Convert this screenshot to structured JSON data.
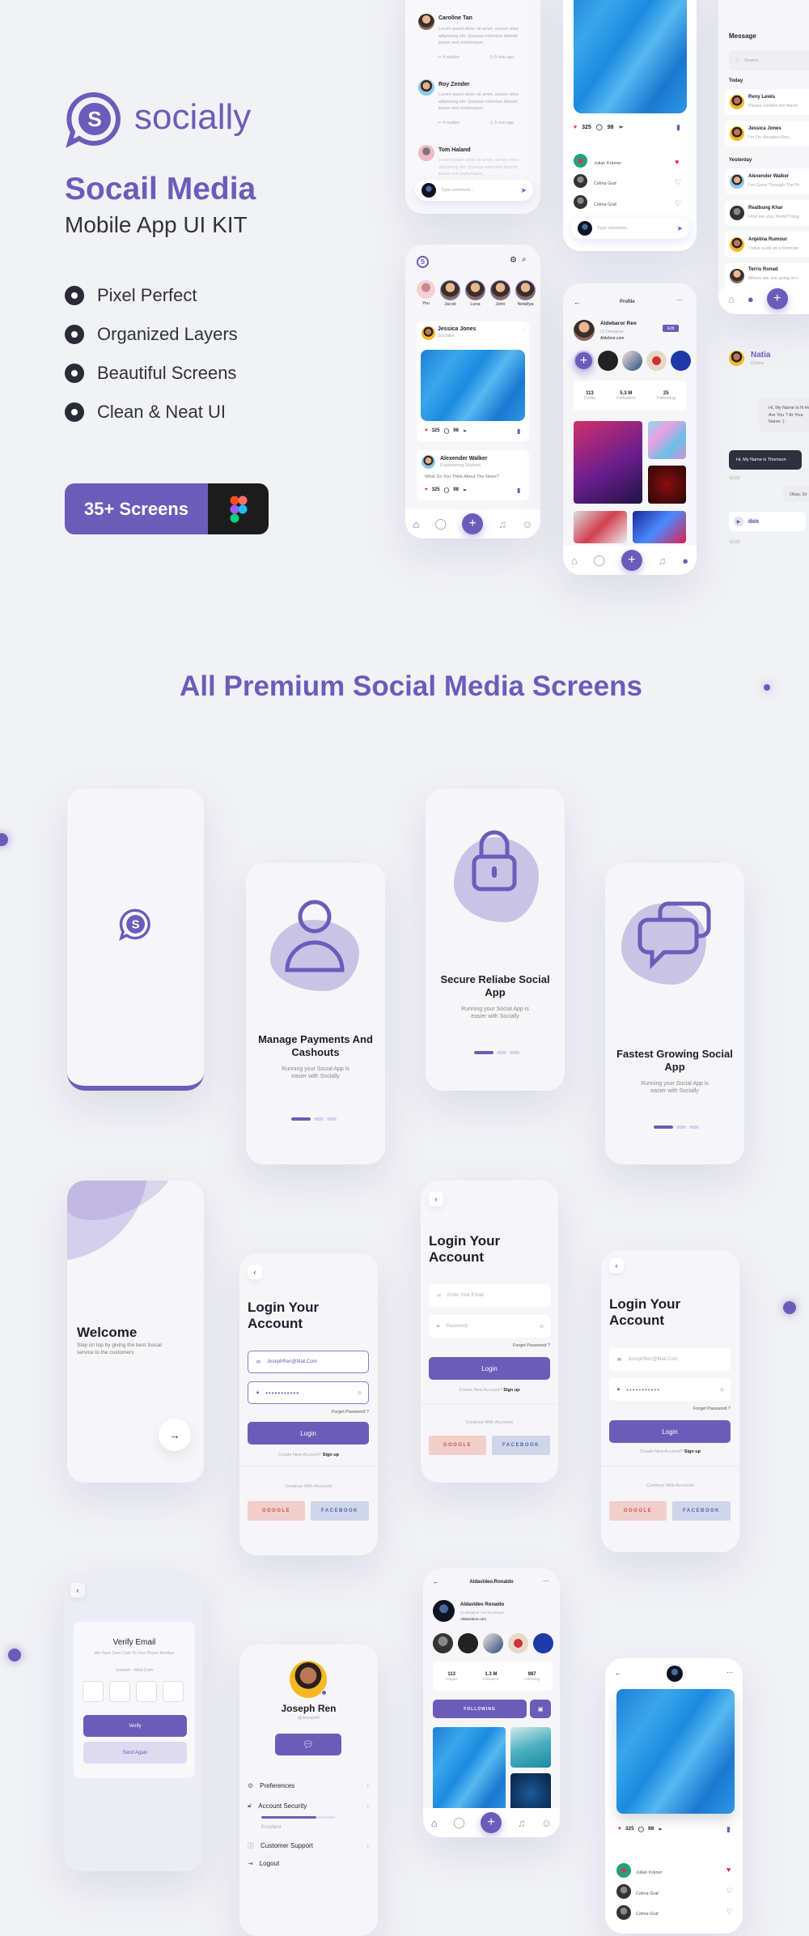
{
  "brand": {
    "name": "socially",
    "logo_letter": "S",
    "title": "Socail Media",
    "subtitle": "Mobile App UI KIT",
    "features": [
      "Pixel Perfect",
      "Organized Layers",
      "Beautiful Screens",
      "Clean & Neat UI"
    ],
    "cta": "35+ Screens",
    "accent": "#6c5cba"
  },
  "section_title": "All Premium Social Media Screens",
  "comments": [
    {
      "name": "Caroline Tan",
      "text": "Lorem ipsum dolor sit amet, consec tetur adipiscing elit. Quisque interdum blandit ipsum sed scelerisque.",
      "replies": "4 replies",
      "time": "5 min ago"
    },
    {
      "name": "Roy Zender",
      "text": "Lorem ipsum dolor sit amet, consec tetur adipiscing elit. Quisque interdum blandit ipsum sed scelerisque.",
      "replies": "4 replies",
      "time": "5 min ago"
    },
    {
      "name": "Tom Haland",
      "text": "Lorem ipsum dolor sit amet, consec tetur adipiscing elit. Quisque interdum blandit ipsum sed scelerisque."
    }
  ],
  "comment_placeholder": "Type comment...",
  "post": {
    "likes": "325",
    "comments": "98",
    "likers": [
      {
        "name": "Julian Krämer",
        "liked": true
      },
      {
        "name": "Celina Graf",
        "liked": false
      },
      {
        "name": "Celina Graf",
        "liked": false
      }
    ]
  },
  "messages": {
    "title": "Message",
    "search": "Search...",
    "today": "Today",
    "yesterday": "Yesterday",
    "items": [
      {
        "name": "Reny Lewis",
        "preview": "Please confirm the friend"
      },
      {
        "name": "Jessica Jones",
        "preview": "I'm On Vocation Ron..."
      },
      {
        "name": "Alexender Walker",
        "preview": "I've Gone Through The Pr"
      },
      {
        "name": "Realbung Khar",
        "preview": "How are you, friend? long"
      },
      {
        "name": "Anjelina Rumour",
        "preview": "I have a job as a foreman"
      },
      {
        "name": "Terris Ronad",
        "preview": "Where are you going at n"
      }
    ]
  },
  "feed": {
    "stories": [
      "You",
      "Jacob",
      "Luna",
      "John",
      "Netallya"
    ],
    "posts": [
      {
        "name": "Jessica Jones",
        "role": "Socialist",
        "likes": "325",
        "comments": "98"
      },
      {
        "name": "Alexender Walker",
        "role": "Engineering Student",
        "text": "What Do You Think About The News?",
        "likes": "325",
        "comments": "98"
      }
    ]
  },
  "profile": {
    "title": "Profile",
    "name": "Aldebaror Reo",
    "role": "UI Designer",
    "site": "Aldebror.com",
    "edit": "Edit",
    "stats": [
      {
        "value": "113",
        "label": "Posts"
      },
      {
        "value": "5.3 M",
        "label": "Followers"
      },
      {
        "value": "25",
        "label": "Following"
      }
    ]
  },
  "chat": {
    "name": "Natia",
    "status": "Online",
    "received": "Hi, My Name Is N How Are You ? Ar Your Name :)",
    "sent": "Hi, My Name is Thomson",
    "time1": "10:53",
    "received2": "Okay, Gr",
    "time2": "10:53"
  },
  "onboarding": [
    {
      "title": "Manage Payments And Cashouts",
      "text": "Running your Social App is easier with Socially"
    },
    {
      "title": "Secure Reliabe Social App",
      "text": "Running your Social App is easier with Socially"
    },
    {
      "title": "Fastest Growing Social App",
      "text": "Running your Social App is easier with Socially"
    }
  ],
  "welcome": {
    "title": "Welcome",
    "text": "Stay on top by giving the best Social service to the customers"
  },
  "login": {
    "title": "Login Your Account",
    "email_value": "JosephRen@Mail.Com",
    "email_placeholder": "Enter Your Email",
    "password_placeholder": "Password",
    "password_mask": "•••••••••••",
    "forget": "Forget Password ?",
    "button": "Login",
    "create": "Create New Account?",
    "signup": "Sign up",
    "continue": "Continue With Accounts",
    "google": "GOOGLE",
    "facebook": "FACEBOOK"
  },
  "verify": {
    "title": "Verify Email",
    "text": "We Have Sent Code To Your Phone Number",
    "email": "Joseph---Mail.Com",
    "verify": "Verify",
    "resend": "Send Again"
  },
  "settings": {
    "name": "Joseph Ren",
    "handle": "@JosephR",
    "items": [
      "Preferences",
      "Account Security",
      "Customer Support",
      "Logout"
    ],
    "security_level": "Excellent",
    "security_progress": 0.75
  },
  "user_profile": {
    "title": "Aldavideo.Ronaldo",
    "name": "Aldavideo Ronaldo",
    "role": "UI Designer And Developer",
    "site": "Aldavideon.com",
    "stats": [
      {
        "value": "113",
        "label": "Images"
      },
      {
        "value": "1.3 M",
        "label": "Followers"
      },
      {
        "value": "987",
        "label": "Following"
      }
    ],
    "follow": "FOLLOWING"
  },
  "post2": {
    "likes": "325",
    "comments": "98",
    "likers": [
      {
        "name": "Julian Kräner",
        "liked": true
      },
      {
        "name": "Celina Graf",
        "liked": false
      },
      {
        "name": "Celina Graf",
        "liked": false
      }
    ]
  }
}
